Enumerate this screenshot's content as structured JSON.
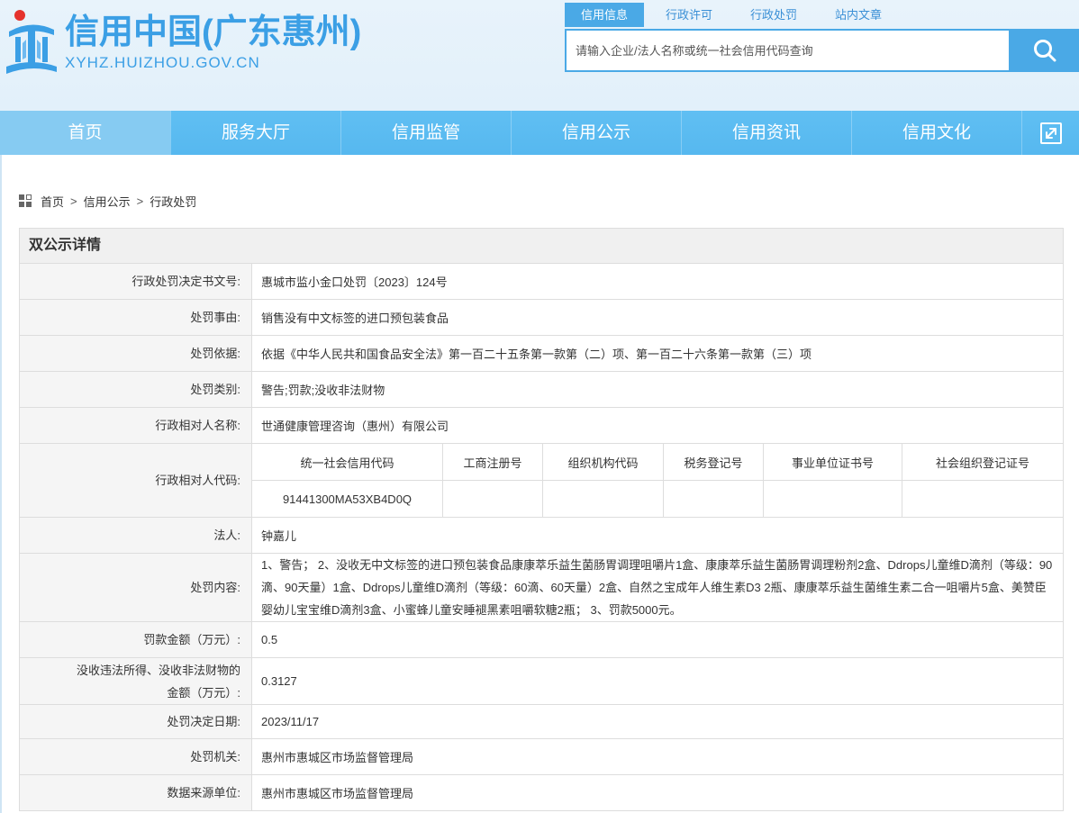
{
  "colors": {
    "brand": "#4aa9e6",
    "title": "#3b9fe5",
    "nav": "#56b8ef",
    "nav_active": "#86cbf2",
    "header_bg": "#e2f0fa"
  },
  "header": {
    "logo_icon": "city-emblem-icon",
    "logo_title": "信用中国(广东惠州)",
    "logo_domain": "XYHZ.HUIZHOU.GOV.CN",
    "tabs": [
      {
        "label": "信用信息",
        "active": true
      },
      {
        "label": "行政许可",
        "active": false
      },
      {
        "label": "行政处罚",
        "active": false
      },
      {
        "label": "站内文章",
        "active": false
      }
    ],
    "search": {
      "placeholder": "请输入企业/法人名称或统一社会信用代码查询",
      "button_icon": "search-icon"
    }
  },
  "nav": {
    "items": [
      {
        "label": "首页",
        "active": true
      },
      {
        "label": "服务大厅",
        "active": false
      },
      {
        "label": "信用监管",
        "active": false
      },
      {
        "label": "信用公示",
        "active": false
      },
      {
        "label": "信用资讯",
        "active": false
      },
      {
        "label": "信用文化",
        "active": false
      }
    ],
    "expand_icon": "fullscreen-icon"
  },
  "breadcrumb": {
    "icon": "grid-icon",
    "separator": ">",
    "items": [
      "首页",
      "信用公示",
      "行政处罚"
    ]
  },
  "detail": {
    "title": "双公示详情",
    "decision_no": {
      "label": "行政处罚决定书文号:",
      "value": "惠城市监小金口处罚〔2023〕124号"
    },
    "reason": {
      "label": "处罚事由:",
      "value": "销售没有中文标签的进口预包装食品"
    },
    "basis": {
      "label": "处罚依据:",
      "value": "依据《中华人民共和国食品安全法》第一百二十五条第一款第（二）项、第一百二十六条第一款第（三）项"
    },
    "category": {
      "label": "处罚类别:",
      "value": "警告;罚款;没收非法财物"
    },
    "party_name": {
      "label": "行政相对人名称:",
      "value": "世通健康管理咨询（惠州）有限公司"
    },
    "party_code": {
      "label": "行政相对人代码:",
      "columns": [
        "统一社会信用代码",
        "工商注册号",
        "组织机构代码",
        "税务登记号",
        "事业单位证书号",
        "社会组织登记证号"
      ],
      "values": [
        "91441300MA53XB4D0Q",
        "",
        "",
        "",
        "",
        ""
      ]
    },
    "legal_person": {
      "label": "法人:",
      "value": "钟嘉儿"
    },
    "content": {
      "label": "处罚内容:",
      "value": "1、警告； 2、没收无中文标签的进口预包装食品康康萃乐益生菌肠胃调理咀嚼片1盒、康康萃乐益生菌肠胃调理粉剂2盒、Ddrops儿童维D滴剂（等级：90滴、90天量）1盒、Ddrops儿童维D滴剂（等级：60滴、60天量）2盒、自然之宝成年人维生素D3 2瓶、康康萃乐益生菌维生素二合一咀嚼片5盒、美赞臣婴幼儿宝宝维D滴剂3盒、小蜜蜂儿童安睡褪黑素咀嚼软糖2瓶； 3、罚款5000元。"
    },
    "fine_amount": {
      "label": "罚款金额（万元）:",
      "value": "0.5"
    },
    "confiscation_amount": {
      "label": "没收违法所得、没收非法财物的金额（万元）:",
      "value": "0.3127"
    },
    "decision_date": {
      "label": "处罚决定日期:",
      "value": "2023/11/17"
    },
    "authority": {
      "label": "处罚机关:",
      "value": "惠州市惠城区市场监督管理局"
    },
    "data_source": {
      "label": "数据来源单位:",
      "value": "惠州市惠城区市场监督管理局"
    }
  }
}
